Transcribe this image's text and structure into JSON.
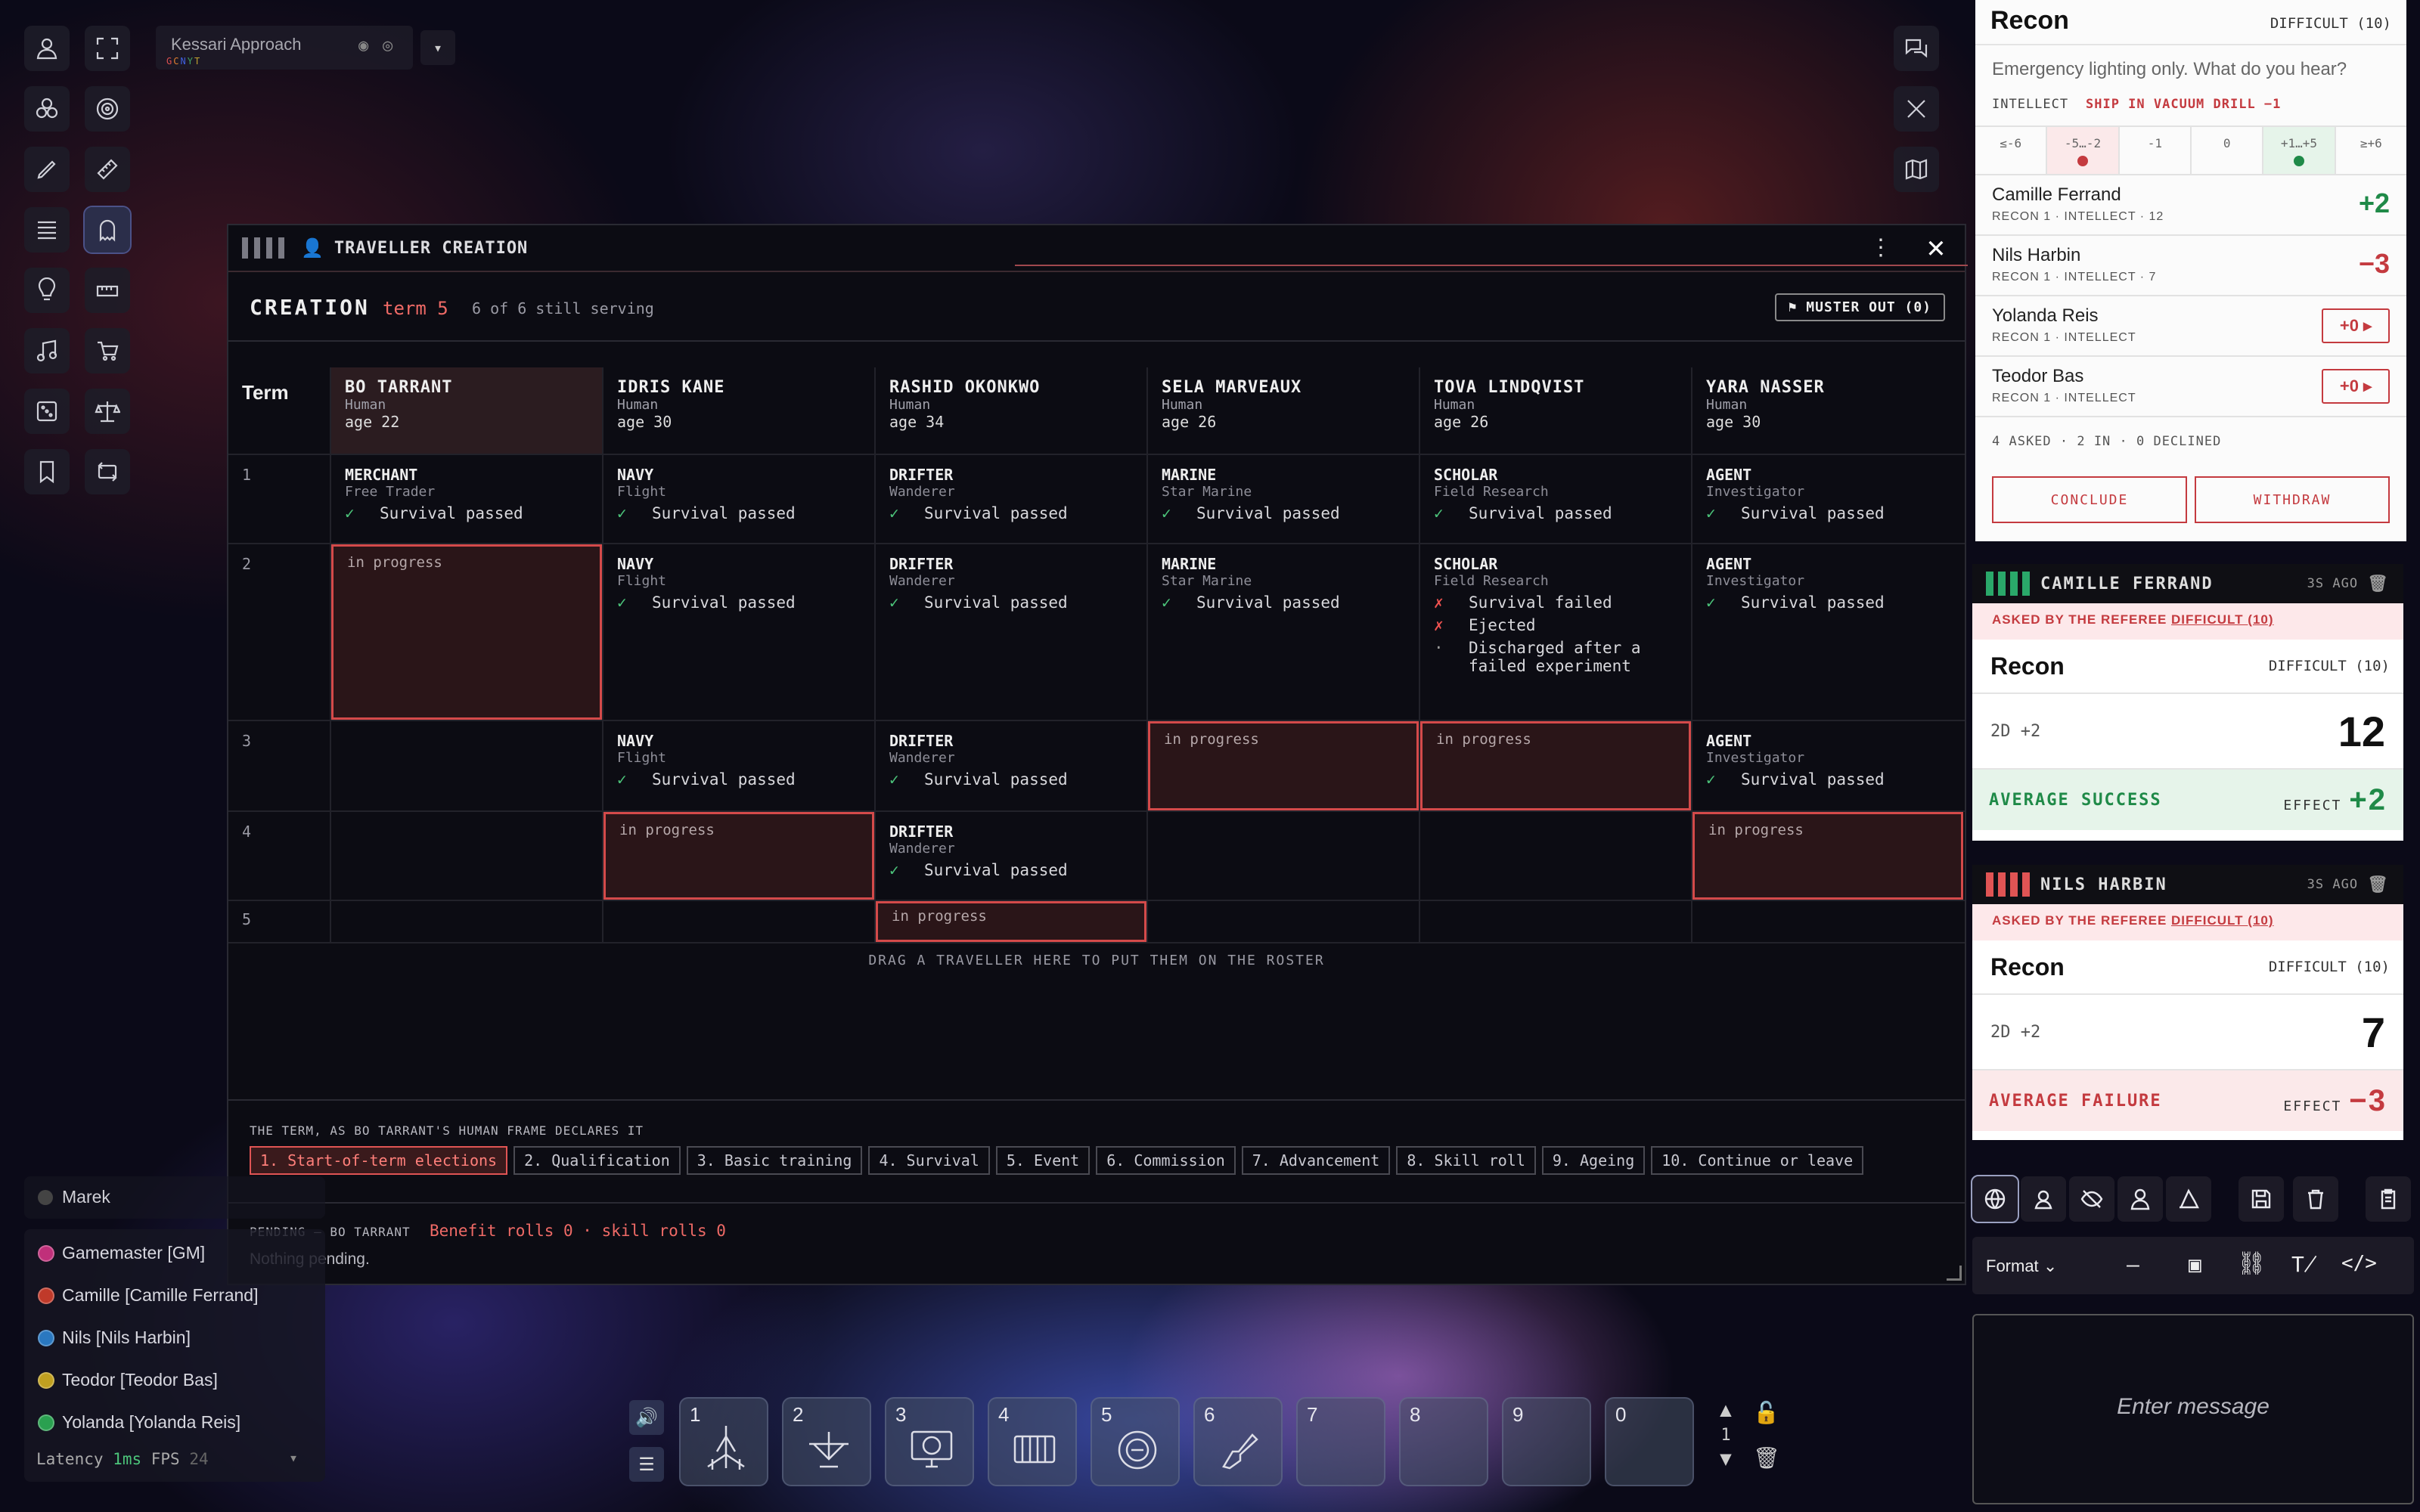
{
  "scene": {
    "name": "Kessari Approach",
    "tags": [
      "G",
      "C",
      "N",
      "Y",
      "T"
    ]
  },
  "panel": {
    "title": "TRAVELLER CREATION"
  },
  "creation": {
    "label": "CREATION",
    "term": "term 5",
    "status": "6 of 6 still serving",
    "muster": "MUSTER OUT (0)",
    "term_header": "Term"
  },
  "travellers": [
    {
      "name": "BO TARRANT",
      "species": "Human",
      "age": "age 22"
    },
    {
      "name": "IDRIS KANE",
      "species": "Human",
      "age": "age 30"
    },
    {
      "name": "RASHID OKONKWO",
      "species": "Human",
      "age": "age 34"
    },
    {
      "name": "SELA MARVEAUX",
      "species": "Human",
      "age": "age 26"
    },
    {
      "name": "TOVA LINDQVIST",
      "species": "Human",
      "age": "age 26"
    },
    {
      "name": "YARA NASSER",
      "species": "Human",
      "age": "age 30"
    }
  ],
  "terms": [
    "1",
    "2",
    "3",
    "4",
    "5"
  ],
  "cells": {
    "passed": "Survival passed",
    "failed": "Survival failed",
    "ejected": "Ejected",
    "discharged": "Discharged after a failed experiment",
    "in_progress": "in progress",
    "merchant": "MERCHANT",
    "free_trader": "Free Trader",
    "navy": "NAVY",
    "flight": "Flight",
    "drifter": "DRIFTER",
    "wanderer": "Wanderer",
    "marine": "MARINE",
    "star_marine": "Star Marine",
    "scholar": "SCHOLAR",
    "field_research": "Field Research",
    "agent": "AGENT",
    "investigator": "Investigator"
  },
  "drag_hint": "DRAG A TRAVELLER HERE TO PUT THEM ON THE ROSTER",
  "steps_label": "THE TERM, AS BO TARRANT'S HUMAN FRAME DECLARES IT",
  "steps": [
    "1. Start-of-term elections",
    "2. Qualification",
    "3. Basic training",
    "4. Survival",
    "5. Event",
    "6. Commission",
    "7. Advancement",
    "8. Skill roll",
    "9. Ageing",
    "10. Continue or leave"
  ],
  "pending": {
    "label": "PENDING — BO TARRANT",
    "values": "Benefit rolls 0 · skill rolls 0",
    "note": "Nothing pending."
  },
  "recon_card": {
    "skill": "Recon",
    "difficulty": "DIFFICULT (10)",
    "prompt": "Emergency lighting only. What do you hear?",
    "characteristic": "INTELLECT",
    "modifier": "SHIP IN VACUUM DRILL −1",
    "scale": [
      "≤-6",
      "-5…-2",
      "-1",
      "0",
      "+1…+5",
      "≥+6"
    ],
    "participants": [
      {
        "name": "Camille Ferrand",
        "sub": "RECON 1 · INTELLECT · 12",
        "value": "+2",
        "color": "#1f8a48"
      },
      {
        "name": "Nils Harbin",
        "sub": "RECON 1 · INTELLECT · 7",
        "value": "−3",
        "color": "#c43a3f"
      },
      {
        "name": "Yolanda Reis",
        "sub": "RECON 1 · INTELLECT",
        "value": "+0"
      },
      {
        "name": "Teodor Bas",
        "sub": "RECON 1 · INTELLECT",
        "value": "+0"
      }
    ],
    "summary": "4 ASKED · 2 IN · 0 DECLINED",
    "conclude": "CONCLUDE",
    "withdraw": "WITHDRAW"
  },
  "rolls": [
    {
      "name": "CAMILLE FERRAND",
      "ago": "3S AGO",
      "asked": "ASKED BY THE REFEREE",
      "asked_diff": "DIFFICULT (10)",
      "skill": "Recon",
      "difficulty": "DIFFICULT (10)",
      "formula": "2D +2",
      "total": "12",
      "outcome": "AVERAGE SUCCESS",
      "effect_label": "EFFECT",
      "effect": "+2",
      "color": "#1f8a48"
    },
    {
      "name": "NILS HARBIN",
      "ago": "3S AGO",
      "asked": "ASKED BY THE REFEREE",
      "asked_diff": "DIFFICULT (10)",
      "skill": "Recon",
      "difficulty": "DIFFICULT (10)",
      "formula": "2D +2",
      "total": "7",
      "outcome": "AVERAGE FAILURE",
      "effect_label": "EFFECT",
      "effect": "−3",
      "color": "#c43a3f"
    }
  ],
  "chat": {
    "format": "Format",
    "placeholder": "Enter message"
  },
  "players": {
    "self": "Marek",
    "list": [
      {
        "name": "Gamemaster [GM]",
        "color": "#c0307a"
      },
      {
        "name": "Camille [Camille Ferrand]",
        "color": "#c03a2a"
      },
      {
        "name": "Nils [Nils Harbin]",
        "color": "#2a78c0"
      },
      {
        "name": "Teodor [Teodor Bas]",
        "color": "#c0a020"
      },
      {
        "name": "Yolanda [Yolanda Reis]",
        "color": "#2aa050"
      }
    ],
    "latency_label": "Latency",
    "latency": "1ms",
    "fps_label": "FPS",
    "fps": "24"
  },
  "hotbar": [
    "1",
    "2",
    "3",
    "4",
    "5",
    "6",
    "7",
    "8",
    "9",
    "0"
  ],
  "hotbar_page": "1"
}
